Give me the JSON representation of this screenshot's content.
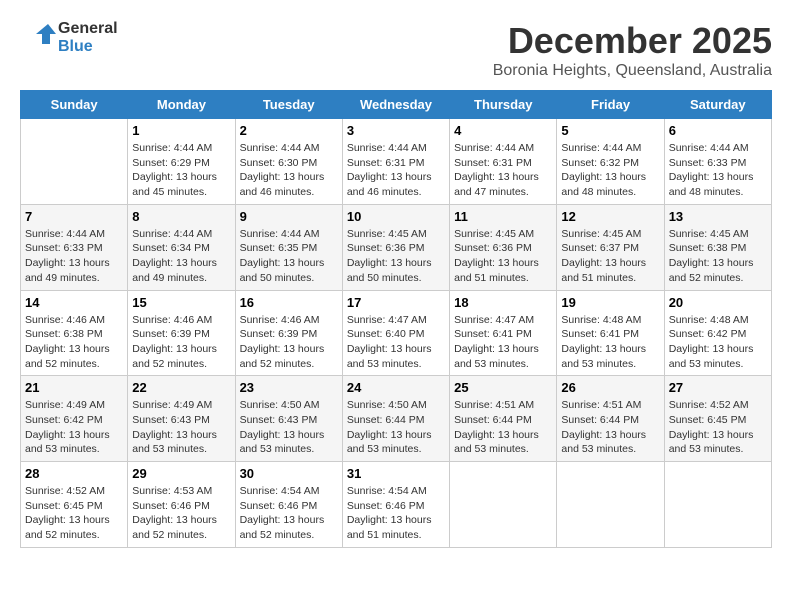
{
  "logo": {
    "general": "General",
    "blue": "Blue"
  },
  "header": {
    "month": "December 2025",
    "location": "Boronia Heights, Queensland, Australia"
  },
  "weekdays": [
    "Sunday",
    "Monday",
    "Tuesday",
    "Wednesday",
    "Thursday",
    "Friday",
    "Saturday"
  ],
  "weeks": [
    [
      {
        "day": null
      },
      {
        "day": 1,
        "sunrise": "4:44 AM",
        "sunset": "6:29 PM",
        "daylight": "13 hours and 45 minutes."
      },
      {
        "day": 2,
        "sunrise": "4:44 AM",
        "sunset": "6:30 PM",
        "daylight": "13 hours and 46 minutes."
      },
      {
        "day": 3,
        "sunrise": "4:44 AM",
        "sunset": "6:31 PM",
        "daylight": "13 hours and 46 minutes."
      },
      {
        "day": 4,
        "sunrise": "4:44 AM",
        "sunset": "6:31 PM",
        "daylight": "13 hours and 47 minutes."
      },
      {
        "day": 5,
        "sunrise": "4:44 AM",
        "sunset": "6:32 PM",
        "daylight": "13 hours and 48 minutes."
      },
      {
        "day": 6,
        "sunrise": "4:44 AM",
        "sunset": "6:33 PM",
        "daylight": "13 hours and 48 minutes."
      }
    ],
    [
      {
        "day": 7,
        "sunrise": "4:44 AM",
        "sunset": "6:33 PM",
        "daylight": "13 hours and 49 minutes."
      },
      {
        "day": 8,
        "sunrise": "4:44 AM",
        "sunset": "6:34 PM",
        "daylight": "13 hours and 49 minutes."
      },
      {
        "day": 9,
        "sunrise": "4:44 AM",
        "sunset": "6:35 PM",
        "daylight": "13 hours and 50 minutes."
      },
      {
        "day": 10,
        "sunrise": "4:45 AM",
        "sunset": "6:36 PM",
        "daylight": "13 hours and 50 minutes."
      },
      {
        "day": 11,
        "sunrise": "4:45 AM",
        "sunset": "6:36 PM",
        "daylight": "13 hours and 51 minutes."
      },
      {
        "day": 12,
        "sunrise": "4:45 AM",
        "sunset": "6:37 PM",
        "daylight": "13 hours and 51 minutes."
      },
      {
        "day": 13,
        "sunrise": "4:45 AM",
        "sunset": "6:38 PM",
        "daylight": "13 hours and 52 minutes."
      }
    ],
    [
      {
        "day": 14,
        "sunrise": "4:46 AM",
        "sunset": "6:38 PM",
        "daylight": "13 hours and 52 minutes."
      },
      {
        "day": 15,
        "sunrise": "4:46 AM",
        "sunset": "6:39 PM",
        "daylight": "13 hours and 52 minutes."
      },
      {
        "day": 16,
        "sunrise": "4:46 AM",
        "sunset": "6:39 PM",
        "daylight": "13 hours and 52 minutes."
      },
      {
        "day": 17,
        "sunrise": "4:47 AM",
        "sunset": "6:40 PM",
        "daylight": "13 hours and 53 minutes."
      },
      {
        "day": 18,
        "sunrise": "4:47 AM",
        "sunset": "6:41 PM",
        "daylight": "13 hours and 53 minutes."
      },
      {
        "day": 19,
        "sunrise": "4:48 AM",
        "sunset": "6:41 PM",
        "daylight": "13 hours and 53 minutes."
      },
      {
        "day": 20,
        "sunrise": "4:48 AM",
        "sunset": "6:42 PM",
        "daylight": "13 hours and 53 minutes."
      }
    ],
    [
      {
        "day": 21,
        "sunrise": "4:49 AM",
        "sunset": "6:42 PM",
        "daylight": "13 hours and 53 minutes."
      },
      {
        "day": 22,
        "sunrise": "4:49 AM",
        "sunset": "6:43 PM",
        "daylight": "13 hours and 53 minutes."
      },
      {
        "day": 23,
        "sunrise": "4:50 AM",
        "sunset": "6:43 PM",
        "daylight": "13 hours and 53 minutes."
      },
      {
        "day": 24,
        "sunrise": "4:50 AM",
        "sunset": "6:44 PM",
        "daylight": "13 hours and 53 minutes."
      },
      {
        "day": 25,
        "sunrise": "4:51 AM",
        "sunset": "6:44 PM",
        "daylight": "13 hours and 53 minutes."
      },
      {
        "day": 26,
        "sunrise": "4:51 AM",
        "sunset": "6:44 PM",
        "daylight": "13 hours and 53 minutes."
      },
      {
        "day": 27,
        "sunrise": "4:52 AM",
        "sunset": "6:45 PM",
        "daylight": "13 hours and 53 minutes."
      }
    ],
    [
      {
        "day": 28,
        "sunrise": "4:52 AM",
        "sunset": "6:45 PM",
        "daylight": "13 hours and 52 minutes."
      },
      {
        "day": 29,
        "sunrise": "4:53 AM",
        "sunset": "6:46 PM",
        "daylight": "13 hours and 52 minutes."
      },
      {
        "day": 30,
        "sunrise": "4:54 AM",
        "sunset": "6:46 PM",
        "daylight": "13 hours and 52 minutes."
      },
      {
        "day": 31,
        "sunrise": "4:54 AM",
        "sunset": "6:46 PM",
        "daylight": "13 hours and 51 minutes."
      },
      {
        "day": null
      },
      {
        "day": null
      },
      {
        "day": null
      }
    ]
  ]
}
